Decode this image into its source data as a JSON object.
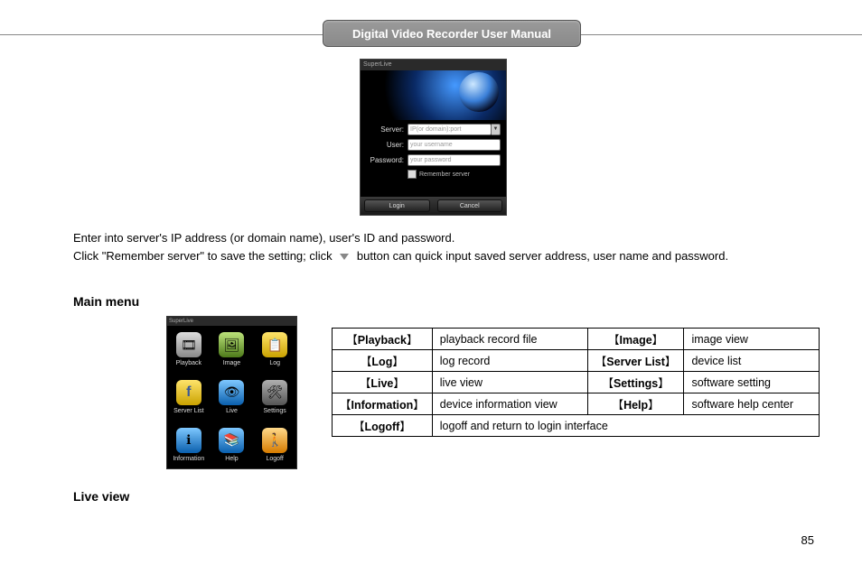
{
  "title_banner": "Digital Video Recorder User Manual",
  "login_screenshot": {
    "app_title": "SuperLive",
    "fields": {
      "server_label": "Server:",
      "server_placeholder": "IP(or domain):port",
      "user_label": "User:",
      "user_placeholder": "your  username",
      "password_label": "Password:",
      "password_placeholder": "your  password",
      "remember_label": "Remember server"
    },
    "buttons": {
      "login": "Login",
      "cancel": "Cancel"
    }
  },
  "intro": {
    "line1": "Enter into server's IP address (or domain name), user's ID and password.",
    "line2a": "Click \"Remember server\" to save the setting; click",
    "line2b": "button can quick input saved server address, user name and password."
  },
  "sections": {
    "main_menu": "Main menu",
    "live_view": "Live view"
  },
  "menu_screenshot": {
    "app_title": "SuperLive",
    "items": [
      {
        "label": "Playback",
        "glyph": "🎞",
        "cls": "ic-gray"
      },
      {
        "label": "Image",
        "glyph": "🖼",
        "cls": "ic-green"
      },
      {
        "label": "Log",
        "glyph": "📋",
        "cls": "ic-yellow"
      },
      {
        "label": "Server List",
        "glyph": "f",
        "cls": "ic-fb"
      },
      {
        "label": "Live",
        "glyph": "👁",
        "cls": "ic-blue"
      },
      {
        "label": "Settings",
        "glyph": "🛠",
        "cls": "ic-steel"
      },
      {
        "label": "Information",
        "glyph": "ℹ",
        "cls": "ic-blue"
      },
      {
        "label": "Help",
        "glyph": "📚",
        "cls": "ic-blue"
      },
      {
        "label": "Logoff",
        "glyph": "🚶",
        "cls": "ic-orange"
      }
    ]
  },
  "func_table": {
    "rows": [
      {
        "k1": "Playback",
        "d1": "playback record file",
        "k2": "Image",
        "d2": "image view"
      },
      {
        "k1": "Log",
        "d1": "log record",
        "k2": "Server List",
        "d2": "device list"
      },
      {
        "k1": "Live",
        "d1": "live view",
        "k2": "Settings",
        "d2": "software setting"
      },
      {
        "k1": "Information",
        "d1": "device information view",
        "k2": "Help",
        "d2": "software help center"
      },
      {
        "k1": "Logoff",
        "d1_full": "logoff and return to login interface"
      }
    ]
  },
  "page_number": "85"
}
